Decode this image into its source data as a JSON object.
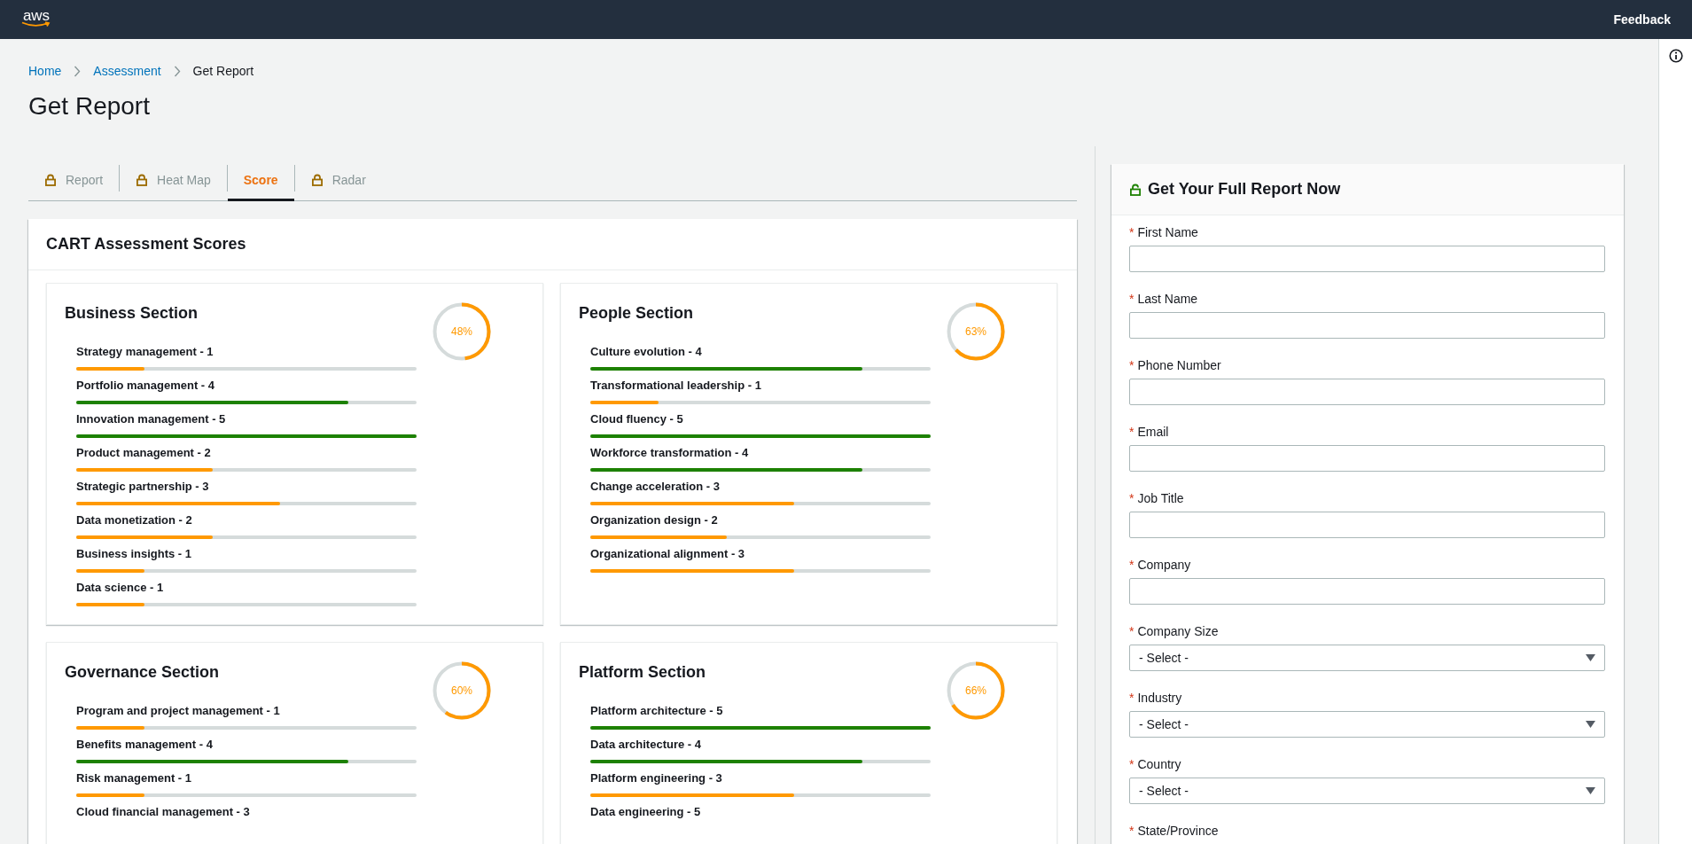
{
  "top_bar": {
    "logo": "aws",
    "feedback": "Feedback"
  },
  "breadcrumb": [
    {
      "label": "Home",
      "kind": "link"
    },
    {
      "label": "Assessment",
      "kind": "link"
    },
    {
      "label": "Get Report",
      "kind": "current"
    }
  ],
  "page_title": "Get Report",
  "tabs": [
    {
      "label": "Report",
      "locked": true,
      "selected": false
    },
    {
      "label": "Heat Map",
      "locked": true,
      "selected": false
    },
    {
      "label": "Score",
      "locked": false,
      "selected": true
    },
    {
      "label": "Radar",
      "locked": true,
      "selected": false
    }
  ],
  "scores_panel": {
    "title": "CART Assessment Scores",
    "sections": [
      {
        "title": "Business Section",
        "level": 0.48,
        "percent": "48%",
        "items": [
          {
            "label": "Strategy management - 1",
            "level": 0.2
          },
          {
            "label": "Portfolio management - 4",
            "level": 0.8
          },
          {
            "label": "Innovation management - 5",
            "level": 1
          },
          {
            "label": "Product management - 2",
            "level": 0.4
          },
          {
            "label": "Strategic partnership - 3",
            "level": 0.6
          },
          {
            "label": "Data monetization - 2",
            "level": 0.4
          },
          {
            "label": "Business insights - 1",
            "level": 0.2
          },
          {
            "label": "Data science - 1",
            "level": 0.2
          }
        ]
      },
      {
        "title": "People Section",
        "level": 0.63,
        "percent": "63%",
        "items": [
          {
            "label": "Culture evolution - 4",
            "level": 0.8
          },
          {
            "label": "Transformational leadership - 1",
            "level": 0.2
          },
          {
            "label": "Cloud fluency - 5",
            "level": 1
          },
          {
            "label": "Workforce transformation - 4",
            "level": 0.8
          },
          {
            "label": "Change acceleration - 3",
            "level": 0.6
          },
          {
            "label": "Organization design - 2",
            "level": 0.4
          },
          {
            "label": "Organizational alignment - 3",
            "level": 0.6
          }
        ]
      },
      {
        "title": "Governance Section",
        "level": 0.6,
        "percent": "60%",
        "items": [
          {
            "label": "Program and project management - 1",
            "level": 0.2
          },
          {
            "label": "Benefits management - 4",
            "level": 0.8
          },
          {
            "label": "Risk management - 1",
            "level": 0.2
          },
          {
            "label": "Cloud financial management - 3"
          }
        ]
      },
      {
        "title": "Platform Section",
        "level": 0.66,
        "percent": "66%",
        "items": [
          {
            "label": "Platform architecture - 5",
            "level": 1
          },
          {
            "label": "Data architecture - 4",
            "level": 0.8
          },
          {
            "label": "Platform engineering - 3",
            "level": 0.6
          },
          {
            "label": "Data engineering - 5"
          }
        ]
      }
    ]
  },
  "form": {
    "title": "Get Your Full Report Now",
    "fields": [
      {
        "label": "First Name",
        "marker": "*",
        "kind": "text"
      },
      {
        "label": "Last Name",
        "marker": "*",
        "kind": "text"
      },
      {
        "label": "Phone Number",
        "marker": "*",
        "kind": "text"
      },
      {
        "label": "Email",
        "marker": "*",
        "kind": "text"
      },
      {
        "label": "Job Title",
        "marker": "*",
        "kind": "text"
      },
      {
        "label": "Company",
        "marker": "*",
        "kind": "text"
      },
      {
        "label": "Company Size",
        "marker": "*",
        "kind": "select",
        "value": "- Select -"
      },
      {
        "label": "Industry",
        "marker": "*",
        "kind": "select",
        "value": "- Select -"
      },
      {
        "label": "Country",
        "marker": "*",
        "kind": "select",
        "value": "- Select -"
      },
      {
        "label": "State/Province",
        "marker": "*"
      }
    ]
  }
}
